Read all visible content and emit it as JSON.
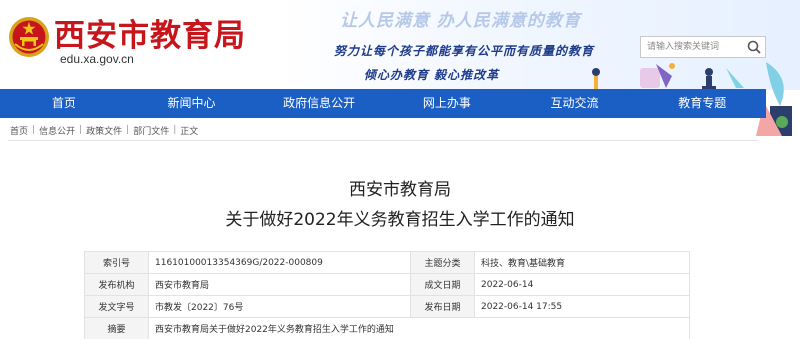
{
  "header": {
    "site_title": "西安市教育局",
    "domain": "edu.xa.gov.cn",
    "slogan_faint": "让人民满意 办人民满意的教育",
    "slogan_line1": "努力让每个孩子都能享有公平而有质量的教育",
    "slogan_line2": "倾心办教育  毅心推改革",
    "search_placeholder": "请输入搜索关键词"
  },
  "nav": {
    "items": [
      "首页",
      "新闻中心",
      "政府信息公开",
      "网上办事",
      "互动交流",
      "教育专题"
    ]
  },
  "breadcrumb": {
    "items": [
      "首页",
      "信息公开",
      "政策文件",
      "部门文件",
      "正文"
    ]
  },
  "article": {
    "publisher": "西安市教育局",
    "title": "关于做好2022年义务教育招生入学工作的通知"
  },
  "info": {
    "index_label": "索引号",
    "index_value": "11610100013354369G/2022-000809",
    "topic_label": "主题分类",
    "topic_value": "科技、教育\\基础教育",
    "org_label": "发布机构",
    "org_value": "西安市教育局",
    "created_label": "成文日期",
    "created_value": "2022-06-14",
    "doc_no_label": "发文字号",
    "doc_no_value": "市教发〔2022〕76号",
    "published_label": "发布日期",
    "published_value": "2022-06-14 17:55",
    "summary_label": "摘要",
    "summary_value": "西安市教育局关于做好2022年义务教育招生入学工作的通知"
  },
  "colors": {
    "brand_red": "#c6151b",
    "nav_blue": "#1b5fc4",
    "slogan_blue": "#1f3c8a"
  },
  "icons": {
    "emblem": "national-emblem-icon",
    "search": "search-icon"
  }
}
